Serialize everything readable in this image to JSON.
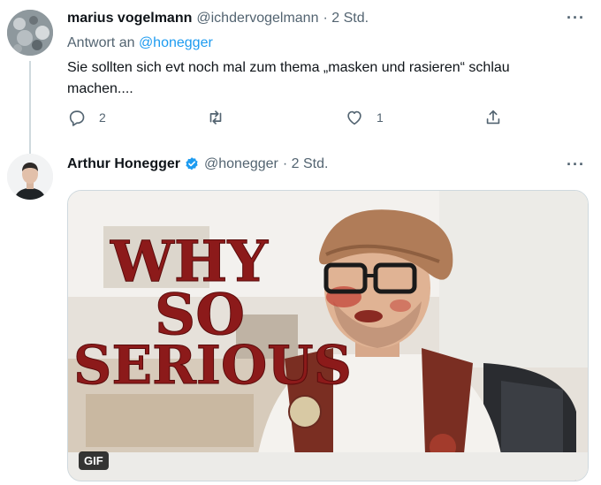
{
  "reply_tweet": {
    "display_name": "marius vogelmann",
    "handle": "@ichdervogelmann",
    "time": "· 2 Std.",
    "more_icon": "···",
    "reply_prefix": "Antwort an ",
    "reply_mention": "@honegger",
    "text": "Sie sollten sich evt noch mal zum thema „masken und rasieren“ schlau machen....",
    "actions": {
      "reply_count": "2",
      "retweet_count": "",
      "like_count": "1"
    }
  },
  "main_tweet": {
    "display_name": "Arthur Honegger",
    "handle": "@honegger",
    "time": "· 2 Std.",
    "more_icon": "···",
    "verified": true,
    "media": {
      "type": "gif",
      "badge": "GIF",
      "overlay_lines": [
        "WHY",
        "SO",
        "SERIOUS"
      ]
    }
  },
  "colors": {
    "accent": "#1d9bf0",
    "secondary_text": "#536471",
    "thread_line": "#cfd9de",
    "overlay_red": "#8c1a1a"
  }
}
